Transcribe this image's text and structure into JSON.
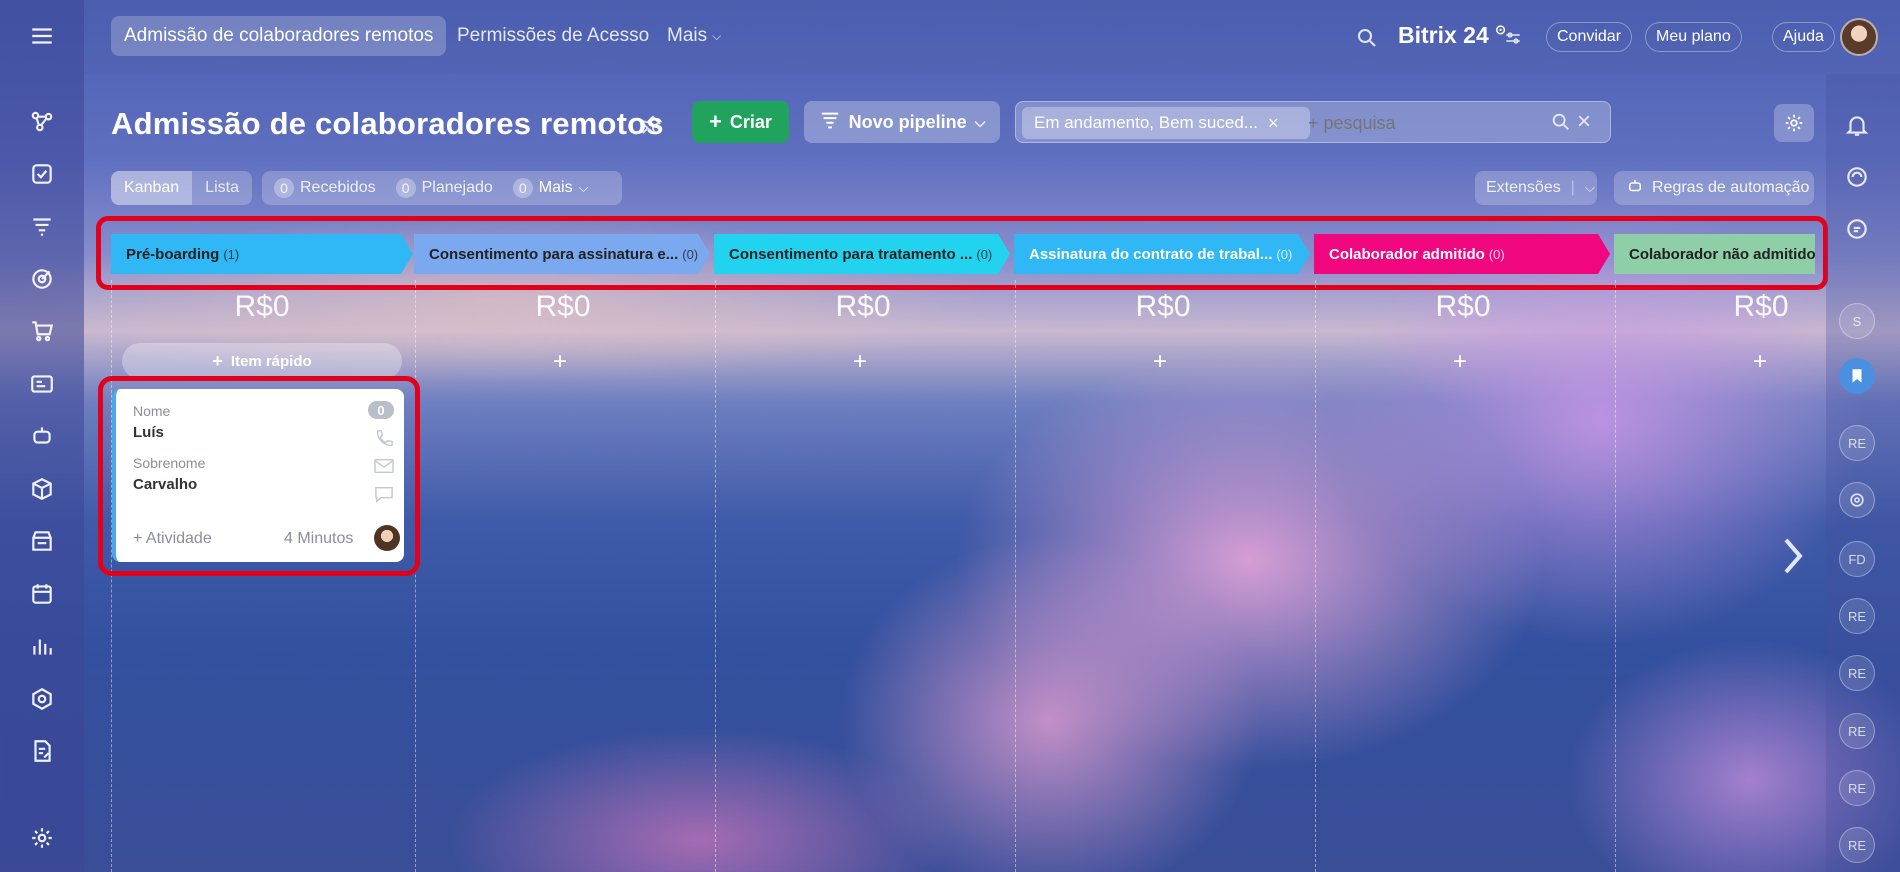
{
  "topbar": {
    "tabs": [
      {
        "label": "Admissão de colaboradores remotos",
        "active": true
      },
      {
        "label": "Permissões de Acesso",
        "active": false
      },
      {
        "label": "Mais",
        "active": false
      }
    ],
    "logo": "Bitrix 24",
    "invite_label": "Convidar",
    "plan_label": "Meu plano",
    "help_label": "Ajuda"
  },
  "header": {
    "title": "Admissão de colaboradores remotos",
    "create_label": "Criar",
    "pipeline_label": "Novo pipeline",
    "filter_chip": "Em andamento, Bem suced...",
    "search_placeholder": "+ pesquisa"
  },
  "toolbar": {
    "view_kanban": "Kanban",
    "view_list": "Lista",
    "received_count": "0",
    "received_label": "Recebidos",
    "planned_count": "0",
    "planned_label": "Planejado",
    "more_count": "0",
    "more_label": "Mais",
    "extensions_label": "Extensões",
    "rules_label": "Regras de automação"
  },
  "stages": [
    {
      "label": "Pré-boarding",
      "count": "(1)",
      "color": "#2fb8f5"
    },
    {
      "label": "Consentimento para assinatura e...",
      "count": "(0)",
      "color": "#7ba9f0"
    },
    {
      "label": "Consentimento para tratamento ...",
      "count": "(0)",
      "color": "#22d3f0"
    },
    {
      "label": "Assinatura do contrato de trabal...",
      "count": "(0)",
      "color": "#2fb8f5"
    },
    {
      "label": "Colaborador admitido",
      "count": "(0)",
      "color": "#f0077f"
    },
    {
      "label": "Colaborador não admitido",
      "count": "",
      "color": "#8ecfa8"
    }
  ],
  "columns": [
    {
      "sum": "R$0"
    },
    {
      "sum": "R$0"
    },
    {
      "sum": "R$0"
    },
    {
      "sum": "R$0"
    },
    {
      "sum": "R$0"
    },
    {
      "sum": "R$0"
    }
  ],
  "quick_item_label": "Item rápido",
  "card": {
    "name_label": "Nome",
    "name_value": "Luís",
    "surname_label": "Sobrenome",
    "surname_value": "Carvalho",
    "badge": "0",
    "activity_label": "+ Atividade",
    "time": "4 Minutos"
  },
  "right_rail": {
    "avatars": [
      "S",
      "RE",
      "FD",
      "RE",
      "RE",
      "RE",
      "RE",
      "RE"
    ]
  }
}
